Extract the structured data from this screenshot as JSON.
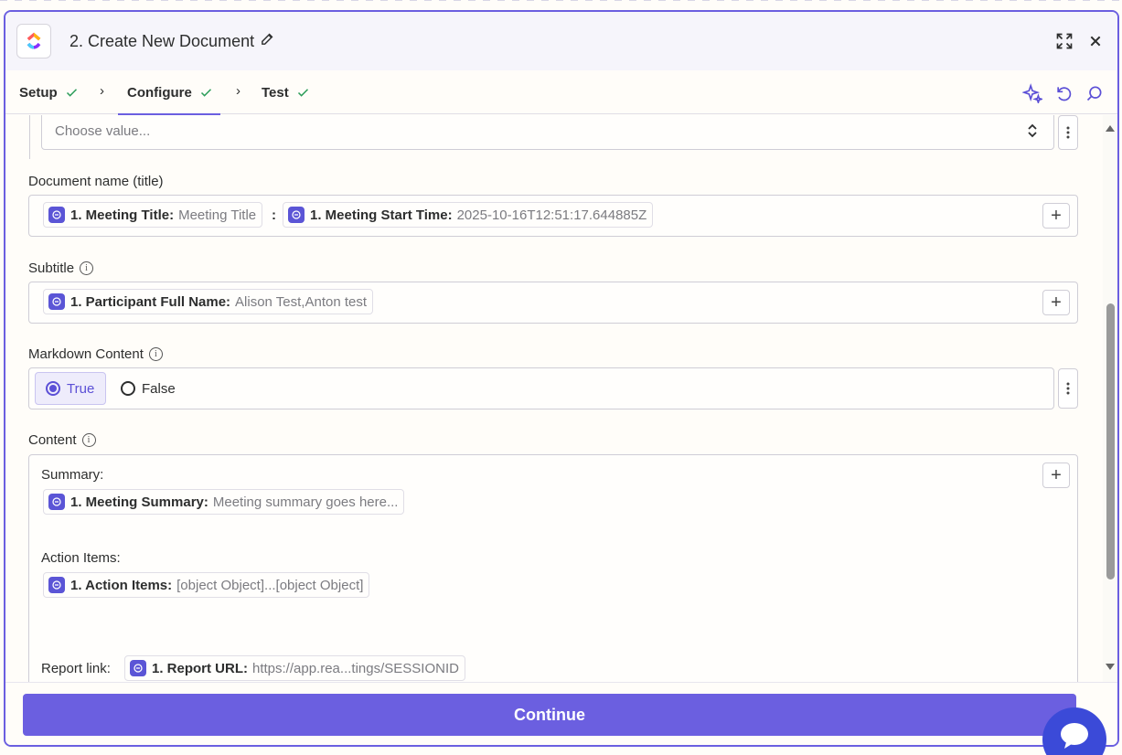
{
  "header": {
    "title": "2. Create New Document",
    "app_logo": "clickup-logo",
    "edit_icon": "pencil-icon",
    "expand_icon": "expand-icon",
    "close_icon": "close-icon"
  },
  "tabs": [
    {
      "label": "Setup",
      "status": "check-icon"
    },
    {
      "label": "Configure",
      "status": "check-icon"
    },
    {
      "label": "Test",
      "status": "check-icon"
    }
  ],
  "toolbar": {
    "ai_icon": "sparkle-icon",
    "reset_icon": "undo-icon",
    "search_icon": "search-icon"
  },
  "choose_value": {
    "placeholder": "Choose value..."
  },
  "document_name": {
    "label": "Document name (title)",
    "pills": [
      {
        "key": "1. Meeting Title:",
        "value": "Meeting Title"
      },
      {
        "key": "1. Meeting Start Time:",
        "value": "2025-10-16T12:51:17.644885Z"
      }
    ],
    "separator": ":"
  },
  "subtitle": {
    "label": "Subtitle",
    "pills": [
      {
        "key": "1. Participant Full Name:",
        "value": "Alison Test,Anton test"
      }
    ]
  },
  "markdown": {
    "label": "Markdown Content",
    "options": [
      {
        "label": "True",
        "selected": true
      },
      {
        "label": "False",
        "selected": false
      }
    ]
  },
  "content": {
    "label": "Content",
    "summary_text": "Summary:",
    "summary_pill": {
      "key": "1. Meeting Summary:",
      "value": "Meeting summary goes here..."
    },
    "action_text": "Action Items:",
    "action_pill": {
      "key": "1. Action Items:",
      "value": "[object Object]...[object Object]"
    },
    "report_text": "Report link:",
    "report_pill": {
      "key": "1. Report URL:",
      "value": "https://app.rea...tings/SESSIONID"
    }
  },
  "footer": {
    "continue_label": "Continue"
  },
  "colors": {
    "accent": "#6b5fe0",
    "check": "#2e9e5b",
    "chat": "#3b4ad8"
  }
}
